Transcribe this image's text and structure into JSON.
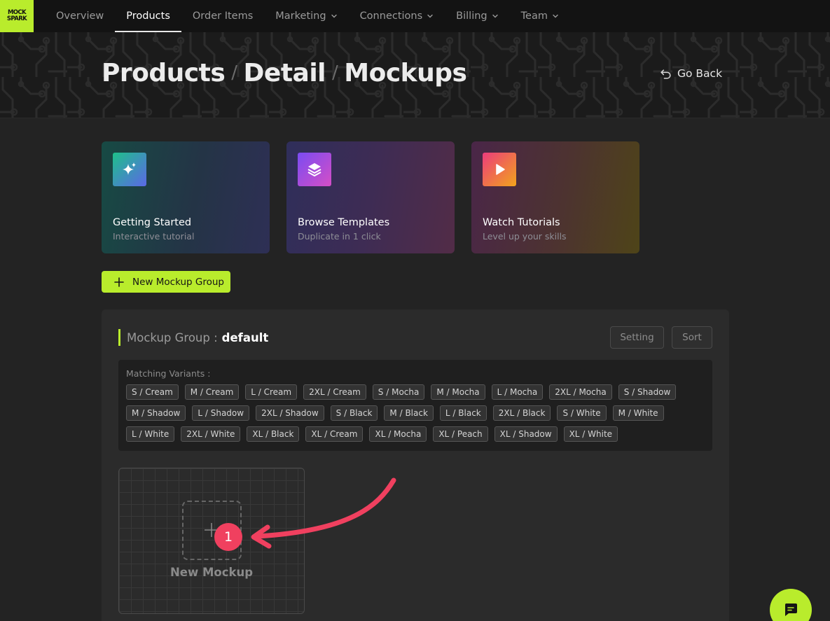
{
  "logo": {
    "line1": "MOCK",
    "line2": "SPARK"
  },
  "nav": {
    "items": [
      {
        "label": "Overview",
        "dropdown": false,
        "active": false
      },
      {
        "label": "Products",
        "dropdown": false,
        "active": true
      },
      {
        "label": "Order Items",
        "dropdown": false,
        "active": false
      },
      {
        "label": "Marketing",
        "dropdown": true,
        "active": false
      },
      {
        "label": "Connections",
        "dropdown": true,
        "active": false
      },
      {
        "label": "Billing",
        "dropdown": true,
        "active": false
      },
      {
        "label": "Team",
        "dropdown": true,
        "active": false
      }
    ]
  },
  "header": {
    "breadcrumb": [
      "Products",
      "Detail",
      "Mockups"
    ],
    "separator": "/",
    "go_back": "Go Back"
  },
  "cards": [
    {
      "title": "Getting Started",
      "subtitle": "Interactive tutorial",
      "icon": "sparkles-icon"
    },
    {
      "title": "Browse Templates",
      "subtitle": "Duplicate in 1 click",
      "icon": "layers-icon"
    },
    {
      "title": "Watch Tutorials",
      "subtitle": "Level up your skills",
      "icon": "play-icon"
    }
  ],
  "new_group_button": "New Mockup Group",
  "group": {
    "label": "Mockup Group :",
    "name": "default",
    "setting_button": "Setting",
    "sort_button": "Sort",
    "variants_label": "Matching Variants :",
    "variants": [
      "S / Cream",
      "M / Cream",
      "L / Cream",
      "2XL / Cream",
      "S / Mocha",
      "M / Mocha",
      "L / Mocha",
      "2XL / Mocha",
      "S / Shadow",
      "M / Shadow",
      "L / Shadow",
      "2XL / Shadow",
      "S / Black",
      "M / Black",
      "L / Black",
      "2XL / Black",
      "S / White",
      "M / White",
      "L / White",
      "2XL / White",
      "XL / Black",
      "XL / Cream",
      "XL / Mocha",
      "XL / Peach",
      "XL / Shadow",
      "XL / White"
    ],
    "new_mockup_label": "New Mockup"
  },
  "annotation": {
    "step": "1"
  },
  "colors": {
    "accent": "#b9ec2c",
    "badge": "#f0405f",
    "background": "#232323"
  }
}
